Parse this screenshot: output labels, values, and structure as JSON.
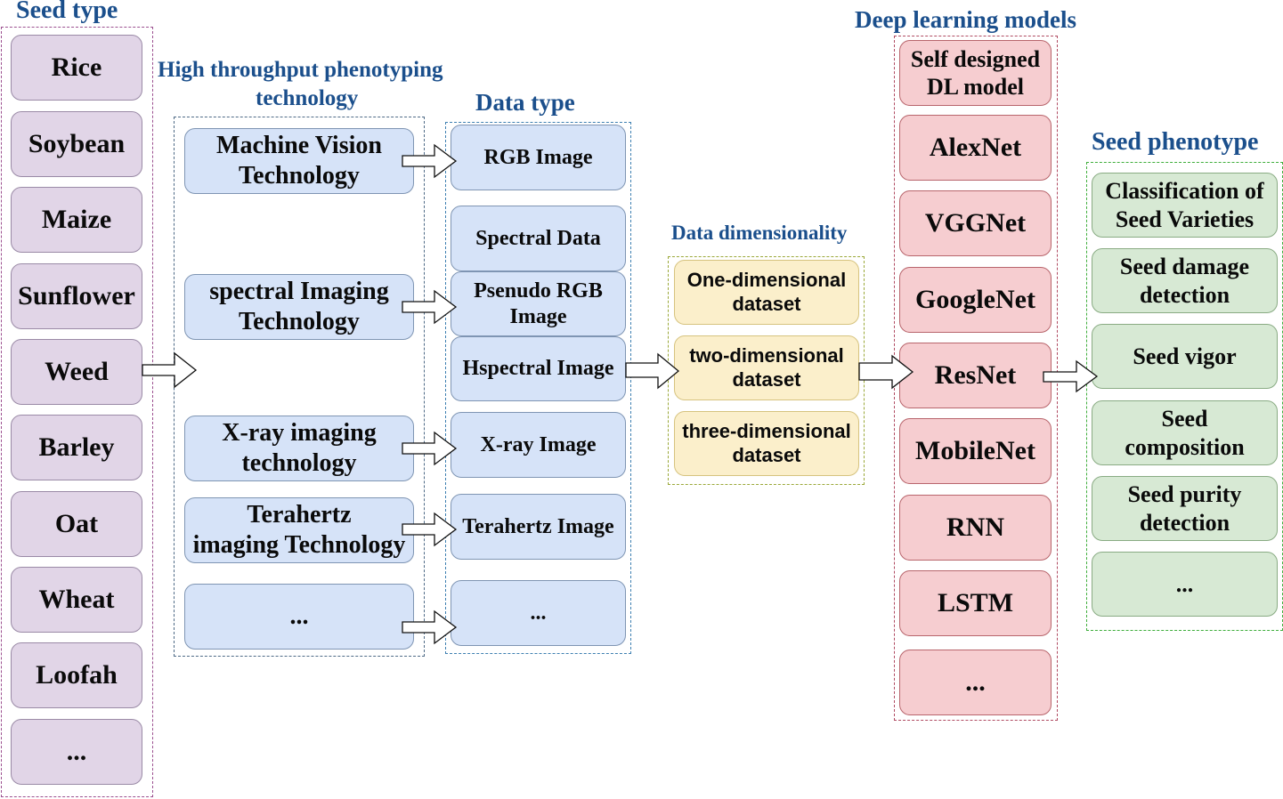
{
  "titles": {
    "seed_type": "Seed type",
    "htp_line1": "High throughput phenotyping",
    "htp_line2": "technology",
    "data_type": "Data type",
    "data_dim": "Data dimensionality",
    "dl_models": "Deep learning models",
    "seed_phenotype": "Seed phenotype"
  },
  "seed_types": [
    "Rice",
    "Soybean",
    "Maize",
    "Sunflower",
    "Weed",
    "Barley",
    "Oat",
    "Wheat",
    "Loofah",
    "..."
  ],
  "technologies": [
    {
      "line1": "Machine Vision",
      "line2": "Technology"
    },
    {
      "line1": "spectral Imaging",
      "line2": "Technology"
    },
    {
      "line1": "X-ray imaging",
      "line2": "technology"
    },
    {
      "line1": "Terahertz",
      "line2": "imaging Technology"
    },
    {
      "line1": "...",
      "line2": ""
    }
  ],
  "data_types": [
    {
      "line1": "RGB Image",
      "line2": ""
    },
    {
      "line1": "Spectral Data",
      "line2": ""
    },
    {
      "line1": "Psenudo RGB",
      "line2": "Image"
    },
    {
      "line1": "Hspectral Image",
      "line2": ""
    },
    {
      "line1": "X-ray Image",
      "line2": ""
    },
    {
      "line1": "Terahertz Image",
      "line2": ""
    },
    {
      "line1": "...",
      "line2": ""
    }
  ],
  "dimensionality": [
    {
      "line1": "One-dimensional",
      "line2": "dataset"
    },
    {
      "line1": "two-dimensional",
      "line2": "dataset"
    },
    {
      "line1": "three-dimensional",
      "line2": "dataset"
    }
  ],
  "dl_models": [
    {
      "line1": "Self designed",
      "line2": "DL model"
    },
    {
      "line1": "AlexNet",
      "line2": ""
    },
    {
      "line1": "VGGNet",
      "line2": ""
    },
    {
      "line1": "GoogleNet",
      "line2": ""
    },
    {
      "line1": "ResNet",
      "line2": ""
    },
    {
      "line1": "MobileNet",
      "line2": ""
    },
    {
      "line1": "RNN",
      "line2": ""
    },
    {
      "line1": "LSTM",
      "line2": ""
    },
    {
      "line1": "...",
      "line2": ""
    }
  ],
  "phenotypes": [
    {
      "line1": "Classification of",
      "line2": "Seed Varieties"
    },
    {
      "line1": "Seed damage",
      "line2": "detection"
    },
    {
      "line1": "Seed vigor",
      "line2": ""
    },
    {
      "line1": "Seed",
      "line2": "composition"
    },
    {
      "line1": "Seed purity",
      "line2": "detection"
    },
    {
      "line1": "...",
      "line2": ""
    }
  ],
  "colors": {
    "title": "#1b4f8c",
    "seed_fill": "#e1d5e7",
    "tech_fill": "#d6e3f8",
    "dim_fill": "#fbefcb",
    "dl_fill": "#f6cdd0",
    "phenotype_fill": "#d7e9d4"
  }
}
